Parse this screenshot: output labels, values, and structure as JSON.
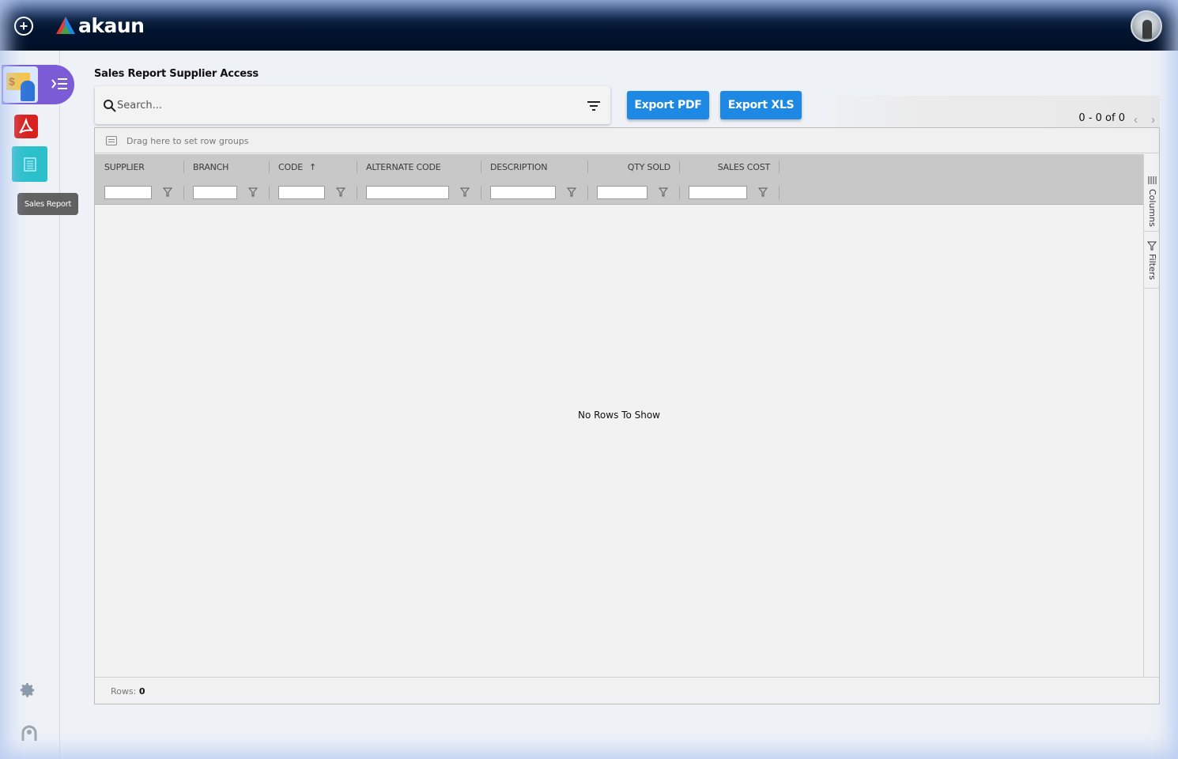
{
  "topbar": {
    "brand": "akaun",
    "colors": {
      "bar_dark": "#000f26",
      "bar_light": "#0a2a66"
    }
  },
  "sidebar": {
    "tooltip": "Sales Report",
    "active_color": "#2cc0cd",
    "tab_color": "#7b5cd6",
    "bill_symbol": "$"
  },
  "page": {
    "title": "Sales Report Supplier Access"
  },
  "search": {
    "placeholder": "Search..."
  },
  "toolbar": {
    "export_pdf_label": "Export PDF",
    "export_xls_label": "Export XLS",
    "button_color": "#1e88e5"
  },
  "pager": {
    "summary": "0 - 0 of 0",
    "prev": "‹",
    "next": "›"
  },
  "grid": {
    "group_hint": "Drag here to set row groups",
    "columns": [
      {
        "label": "SUPPLIER"
      },
      {
        "label": "BRANCH"
      },
      {
        "label": "CODE",
        "sort_arrow": "↑"
      },
      {
        "label": "ALTERNATE CODE"
      },
      {
        "label": "DESCRIPTION"
      },
      {
        "label": "QTY SOLD"
      },
      {
        "label": "SALES COST"
      }
    ],
    "empty_message": "No Rows To Show",
    "side_tabs": {
      "columns": "Columns",
      "filters": "Filters"
    },
    "rows_label": "Rows:",
    "rows_count": "0"
  }
}
